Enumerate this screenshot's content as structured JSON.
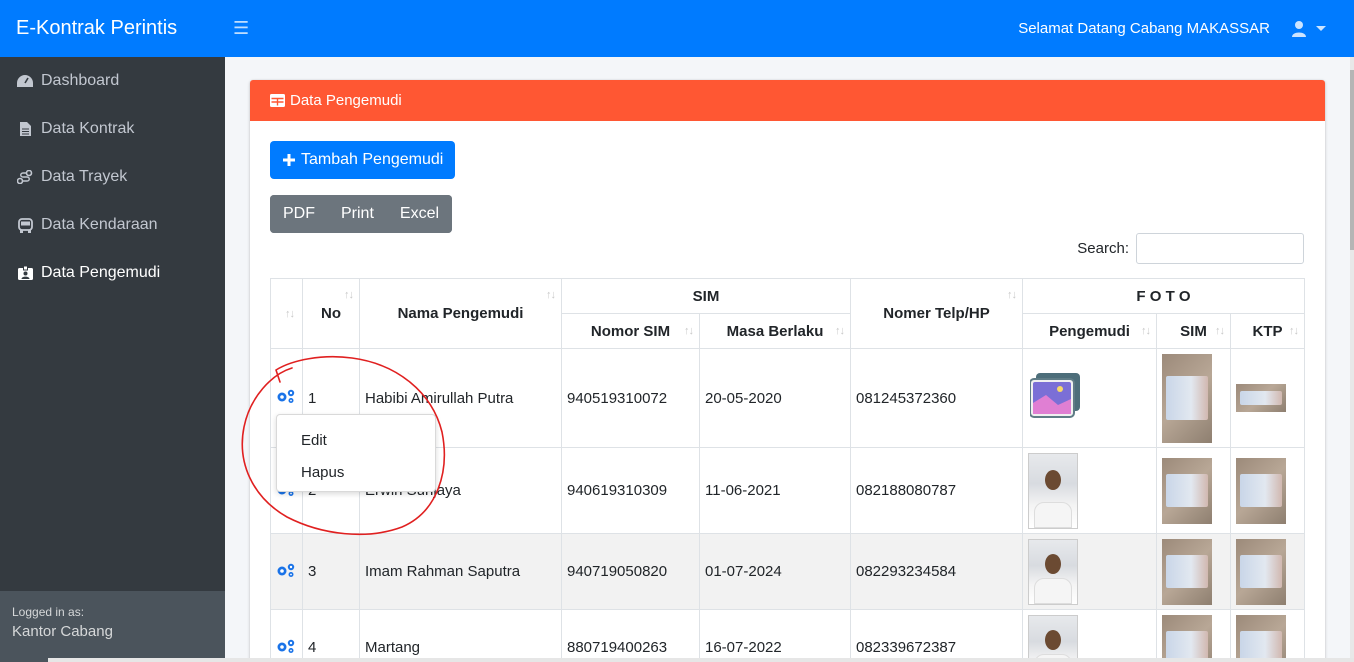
{
  "app": {
    "brand": "E-Kontrak Perintis",
    "welcome": "Selamat Datang Cabang MAKASSAR"
  },
  "sidebar": {
    "items": [
      {
        "label": "Dashboard",
        "icon": "tachometer-icon"
      },
      {
        "label": "Data Kontrak",
        "icon": "file-icon"
      },
      {
        "label": "Data Trayek",
        "icon": "route-icon"
      },
      {
        "label": "Data Kendaraan",
        "icon": "bus-icon"
      },
      {
        "label": "Data Pengemudi",
        "icon": "id-badge-icon",
        "active": true
      }
    ],
    "logged_in_label": "Logged in as:",
    "logged_in_user": "Kantor Cabang"
  },
  "card": {
    "title": "Data Pengemudi",
    "add_button": "Tambah Pengemudi",
    "export_buttons": [
      "PDF",
      "Print",
      "Excel"
    ],
    "search_label": "Search:"
  },
  "table": {
    "headers": {
      "no": "No",
      "nama": "Nama Pengemudi",
      "sim_group": "SIM",
      "nomor_sim": "Nomor SIM",
      "masa_berlaku": "Masa Berlaku",
      "telp": "Nomer Telp/HP",
      "foto_group": "F O T O",
      "foto_pengemudi": "Pengemudi",
      "foto_sim": "SIM",
      "foto_ktp": "KTP"
    },
    "rows": [
      {
        "no": "1",
        "nama": "Habibi Amirullah Putra",
        "nomor_sim": "940519310072",
        "masa_berlaku": "20-05-2020",
        "telp": "081245372360"
      },
      {
        "no": "2",
        "nama": "Erwin Sunjaya",
        "nomor_sim": "940619310309",
        "masa_berlaku": "11-06-2021",
        "telp": "082188080787"
      },
      {
        "no": "3",
        "nama": "Imam Rahman Saputra",
        "nomor_sim": "940719050820",
        "masa_berlaku": "01-07-2024",
        "telp": "082293234584"
      },
      {
        "no": "4",
        "nama": "Martang",
        "nomor_sim": "880719400263",
        "masa_berlaku": "16-07-2022",
        "telp": "082339672387"
      }
    ]
  },
  "action_menu": {
    "edit": "Edit",
    "hapus": "Hapus"
  },
  "colors": {
    "navbar": "#007bff",
    "sidebar": "#343a40",
    "card_header": "#ff5733",
    "annotation": "#e02020"
  }
}
